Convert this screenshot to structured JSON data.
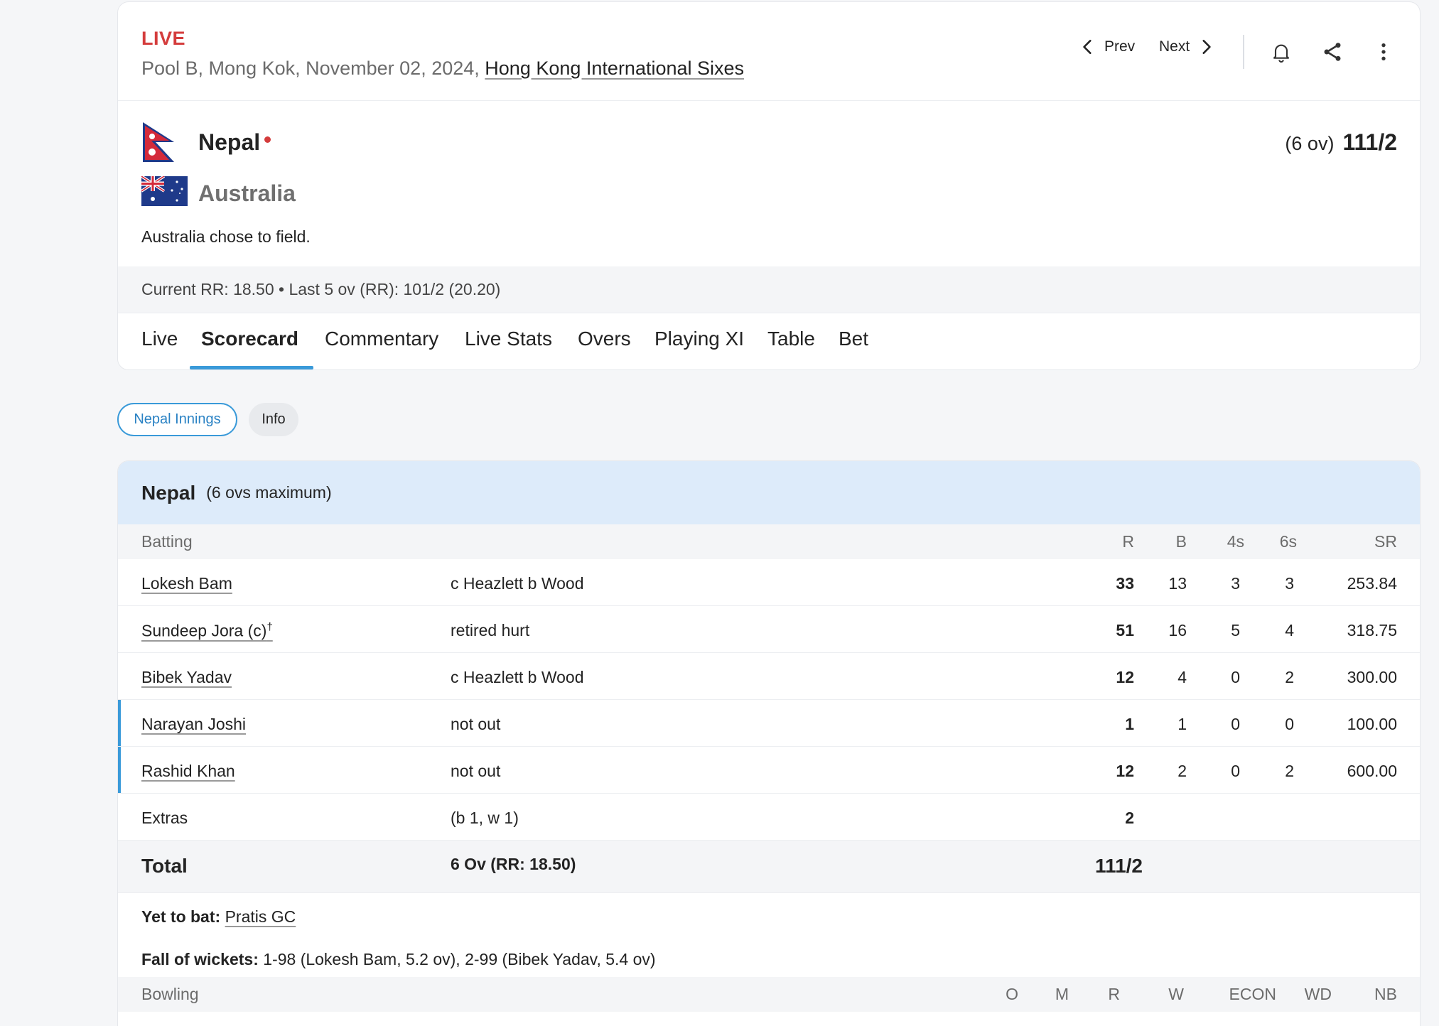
{
  "match": {
    "status": "LIVE",
    "info": "Pool B, Mong Kok, November 02, 2024,",
    "series": "Hong Kong International Sixes",
    "prev_label": "Prev",
    "next_label": "Next"
  },
  "teams": {
    "batting": {
      "name": "Nepal",
      "overs": "(6 ov)",
      "score": "111/2"
    },
    "bowling": {
      "name": "Australia"
    },
    "toss": "Australia chose to field."
  },
  "run_rate": "Current RR: 18.50 • Last 5 ov (RR): 101/2 (20.20)",
  "tabs": [
    "Live",
    "Scorecard",
    "Commentary",
    "Live Stats",
    "Overs",
    "Playing XI",
    "Table",
    "Bet"
  ],
  "active_tab": "Scorecard",
  "pills": [
    "Nepal Innings",
    "Info"
  ],
  "innings": {
    "team": "Nepal",
    "subtitle": "(6 ovs maximum)",
    "batting_header": {
      "label": "Batting",
      "r": "R",
      "b": "B",
      "fours": "4s",
      "sixes": "6s",
      "sr": "SR"
    },
    "batters": [
      {
        "name": "Lokesh Bam",
        "mark": "",
        "dismissal": "c Heazlett b Wood",
        "r": "33",
        "b": "13",
        "fours": "3",
        "sixes": "3",
        "sr": "253.84"
      },
      {
        "name": "Sundeep Jora (c)",
        "mark": "†",
        "dismissal": "retired hurt",
        "r": "51",
        "b": "16",
        "fours": "5",
        "sixes": "4",
        "sr": "318.75"
      },
      {
        "name": "Bibek Yadav",
        "mark": "",
        "dismissal": "c Heazlett b Wood",
        "r": "12",
        "b": "4",
        "fours": "0",
        "sixes": "2",
        "sr": "300.00"
      },
      {
        "name": "Narayan Joshi",
        "mark": "",
        "dismissal": "not out",
        "r": "1",
        "b": "1",
        "fours": "0",
        "sixes": "0",
        "sr": "100.00"
      },
      {
        "name": "Rashid Khan",
        "mark": "",
        "dismissal": "not out",
        "r": "12",
        "b": "2",
        "fours": "0",
        "sixes": "2",
        "sr": "600.00"
      }
    ],
    "extras": {
      "label": "Extras",
      "detail": "(b 1, w 1)",
      "value": "2"
    },
    "total": {
      "label": "Total",
      "detail": "6 Ov (RR: 18.50)",
      "value": "111/2"
    },
    "yet_to_bat": {
      "label": "Yet to bat:",
      "players": "Pratis GC"
    },
    "fall_of_wickets": {
      "label": "Fall of wickets:",
      "value": "1-98 (Lokesh Bam, 5.2 ov), 2-99 (Bibek Yadav, 5.4 ov)"
    },
    "bowling_header": {
      "label": "Bowling",
      "o": "O",
      "m": "M",
      "r": "R",
      "w": "W",
      "econ": "ECON",
      "wd": "WD",
      "nb": "NB"
    }
  }
}
